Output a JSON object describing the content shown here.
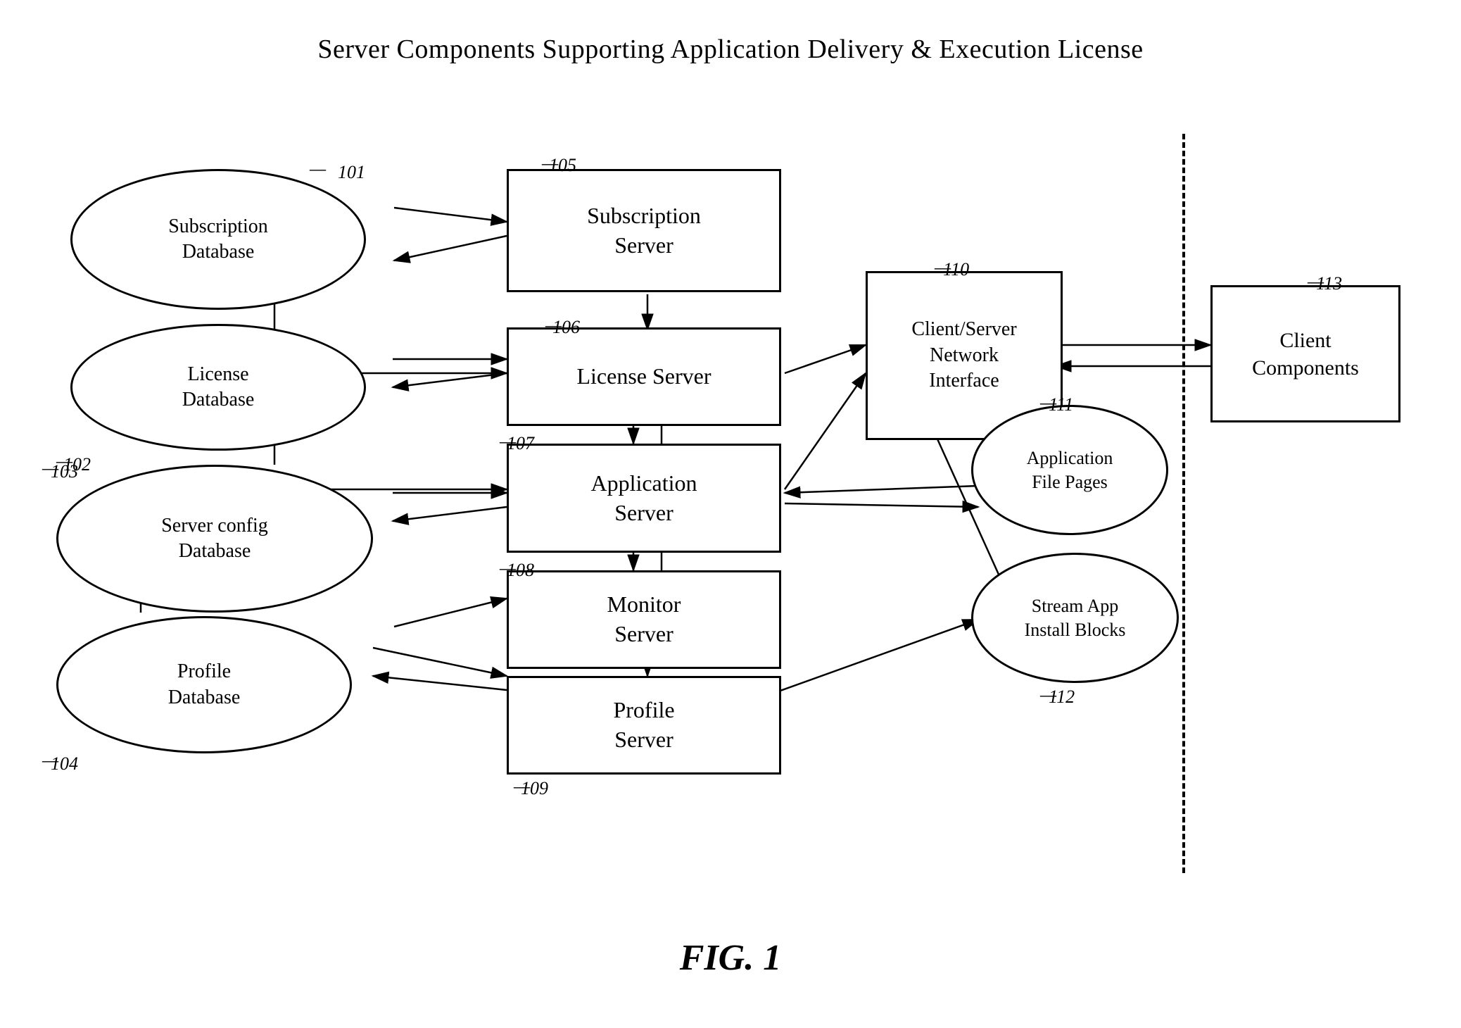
{
  "title": "Server Components Supporting Application Delivery & Execution License",
  "fig_label": "FIG. 1",
  "nodes": {
    "subscription_db": {
      "label": "Subscription\nDatabase",
      "ref": "101"
    },
    "license_db": {
      "label": "License\nDatabase",
      "ref": "102"
    },
    "server_config_db": {
      "label": "Server config\nDatabase",
      "ref": "103"
    },
    "profile_db": {
      "label": "Profile\nDatabase",
      "ref": "104"
    },
    "subscription_server": {
      "label": "Subscription\nServer",
      "ref": "105"
    },
    "license_server": {
      "label": "License Server",
      "ref": "106"
    },
    "application_server": {
      "label": "Application\nServer",
      "ref": "107"
    },
    "monitor_server": {
      "label": "Monitor\nServer",
      "ref": "108"
    },
    "profile_server": {
      "label": "Profile\nServer",
      "ref": "109"
    },
    "client_server_interface": {
      "label": "Client/Server\nNetwork\nInterface",
      "ref": "110"
    },
    "application_file_pages": {
      "label": "Application\nFile Pages",
      "ref": "111"
    },
    "stream_app_install": {
      "label": "Stream App\nInstall Blocks",
      "ref": "112"
    },
    "client_components": {
      "label": "Client\nComponents",
      "ref": "113"
    }
  }
}
